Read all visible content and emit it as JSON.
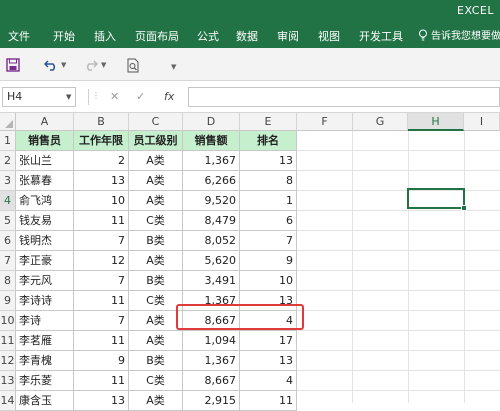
{
  "app": {
    "title": "EXCEL"
  },
  "ribbon": {
    "tabs": [
      "文件",
      "开始",
      "插入",
      "页面布局",
      "公式",
      "数据",
      "审阅",
      "视图",
      "开发工具"
    ],
    "tell_me": "告诉我您想要做什么"
  },
  "formula_bar": {
    "name_box": "H4",
    "fx_label": "fx",
    "formula": ""
  },
  "columns": [
    "A",
    "B",
    "C",
    "D",
    "E",
    "F",
    "G",
    "H",
    "I"
  ],
  "selected_cell": "H4",
  "table": {
    "headers": [
      "销售员",
      "工作年限",
      "员工级别",
      "销售额",
      "排名"
    ],
    "rows": [
      [
        "张山兰",
        "2",
        "A类",
        "1,367",
        "13"
      ],
      [
        "张慕春",
        "13",
        "A类",
        "6,266",
        "8"
      ],
      [
        "俞飞鸿",
        "10",
        "A类",
        "9,520",
        "1"
      ],
      [
        "钱友易",
        "11",
        "C类",
        "8,479",
        "6"
      ],
      [
        "钱明杰",
        "7",
        "B类",
        "8,052",
        "7"
      ],
      [
        "李正豪",
        "12",
        "A类",
        "5,620",
        "9"
      ],
      [
        "李元风",
        "7",
        "B类",
        "3,491",
        "10"
      ],
      [
        "李诗诗",
        "11",
        "C类",
        "1,367",
        "13"
      ],
      [
        "李诗",
        "7",
        "A类",
        "8,667",
        "4"
      ],
      [
        "李茗雁",
        "11",
        "A类",
        "1,094",
        "17"
      ],
      [
        "李青槐",
        "9",
        "B类",
        "1,367",
        "13"
      ],
      [
        "李乐菱",
        "11",
        "C类",
        "8,667",
        "4"
      ],
      [
        "康含玉",
        "13",
        "A类",
        "2,915",
        "11"
      ]
    ]
  },
  "highlighted_row": 10,
  "colors": {
    "excel_green": "#217346",
    "header_fill": "#c6efce",
    "highlight": "#e03b3b"
  }
}
